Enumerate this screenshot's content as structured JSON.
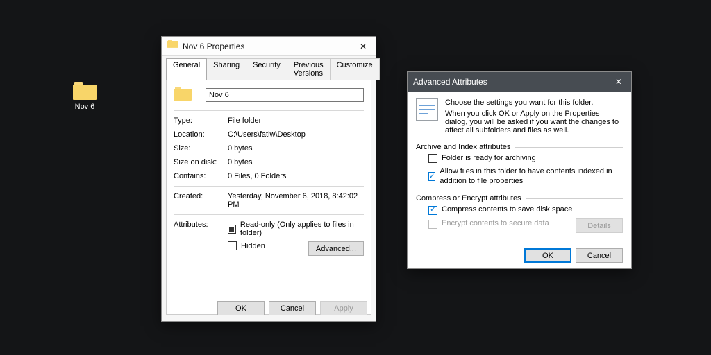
{
  "desktop": {
    "folder_name": "Nov 6"
  },
  "props": {
    "title": "Nov 6 Properties",
    "tabs": [
      "General",
      "Sharing",
      "Security",
      "Previous Versions",
      "Customize"
    ],
    "name_value": "Nov 6",
    "rows": {
      "type_k": "Type:",
      "type_v": "File folder",
      "loc_k": "Location:",
      "loc_v": "C:\\Users\\fatiw\\Desktop",
      "size_k": "Size:",
      "size_v": "0 bytes",
      "sod_k": "Size on disk:",
      "sod_v": "0 bytes",
      "cont_k": "Contains:",
      "cont_v": "0 Files, 0 Folders",
      "created_k": "Created:",
      "created_v": "Yesterday, November 6, 2018, 8:42:02 PM",
      "attr_k": "Attributes:"
    },
    "readonly_label": "Read-only (Only applies to files in folder)",
    "hidden_label": "Hidden",
    "advanced_btn": "Advanced...",
    "ok": "OK",
    "cancel": "Cancel",
    "apply": "Apply"
  },
  "adv": {
    "title": "Advanced Attributes",
    "intro1": "Choose the settings you want for this folder.",
    "intro2": "When you click OK or Apply on the Properties dialog, you will be asked if you want the changes to affect all subfolders and files as well.",
    "group1": "Archive and Index attributes",
    "archive": "Folder is ready for archiving",
    "index": "Allow files in this folder to have contents indexed in addition to file properties",
    "group2": "Compress or Encrypt attributes",
    "compress": "Compress contents to save disk space",
    "encrypt": "Encrypt contents to secure data",
    "details": "Details",
    "ok": "OK",
    "cancel": "Cancel"
  }
}
